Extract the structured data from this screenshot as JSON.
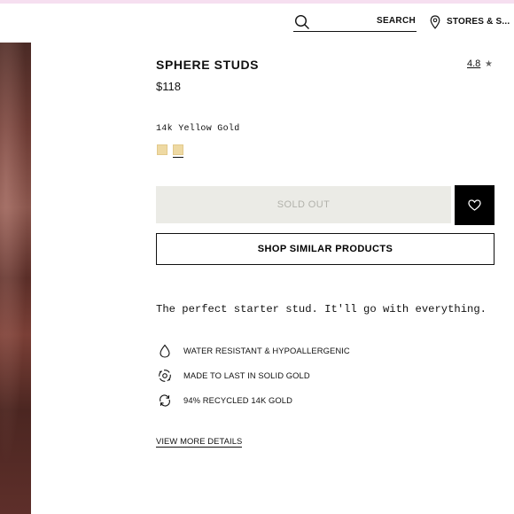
{
  "header": {
    "search": {
      "label": "SEARCH",
      "placeholder": ""
    },
    "stores_label": "STORES & S..."
  },
  "product": {
    "title": "SPHERE STUDS",
    "rating": "4.8",
    "price": "$118",
    "variant": "14k Yellow Gold",
    "swatches": [
      {
        "name": "yellow-gold-1",
        "color": "#eed9a3",
        "selected": false
      },
      {
        "name": "yellow-gold-2",
        "color": "#eed9a3",
        "selected": true
      }
    ],
    "sold_out_label": "SOLD OUT",
    "shop_similar_label": "SHOP SIMILAR PRODUCTS",
    "description": "The perfect starter stud. It'll go with everything.",
    "features": [
      {
        "icon": "water-drop-icon",
        "label": "WATER RESISTANT & HYPOALLERGENIC"
      },
      {
        "icon": "gold-quality-icon",
        "label": "MADE TO LAST IN SOLID GOLD"
      },
      {
        "icon": "recycle-icon",
        "label": "94% RECYCLED 14K GOLD"
      }
    ],
    "details_link": "VIEW MORE DETAILS"
  },
  "colors": {
    "accent_bar": "#f6dff0",
    "sold_out_bg": "#ebebe6",
    "sold_out_text": "#b2b2ab",
    "wishlist_bg": "#000000"
  }
}
